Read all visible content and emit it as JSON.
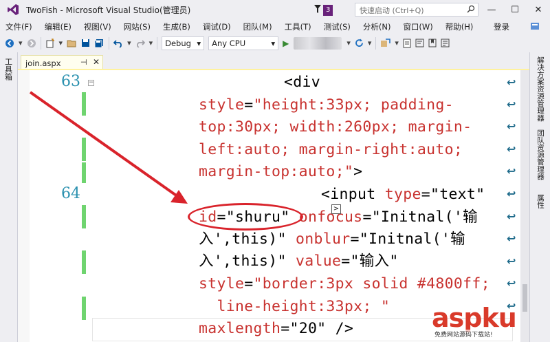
{
  "window": {
    "title": "TwoFish - Microsoft Visual Studio(管理员)",
    "notification_count": "3",
    "quick_launch_placeholder": "快速启动 (Ctrl+Q)",
    "controls": {
      "minimize": "—",
      "maximize": "☐",
      "close": "✕"
    }
  },
  "menu": {
    "items": [
      "文件(F)",
      "编辑(E)",
      "视图(V)",
      "网站(S)",
      "生成(B)",
      "调试(D)",
      "团队(M)",
      "工具(T)",
      "测试(S)",
      "分析(N)",
      "窗口(W)",
      "帮助(H)"
    ],
    "login": "登录"
  },
  "toolbar": {
    "configuration": "Debug",
    "platform": "Any CPU"
  },
  "left_dock": {
    "label": "工具箱"
  },
  "right_dock": {
    "labels": [
      "解决方案资源管理器",
      "团队资源管理器",
      "属性"
    ]
  },
  "document_tab": {
    "name": "join.aspx",
    "pin": "⊣",
    "close": "✕"
  },
  "editor": {
    "line_numbers": [
      "63",
      "64"
    ],
    "lines": [
      {
        "parts": [
          [
            "tag",
            "<div"
          ]
        ]
      },
      {
        "parts": [
          [
            "attr",
            "style"
          ],
          [
            "eq",
            "="
          ],
          [
            "attr",
            "\"height:33px; padding-"
          ]
        ]
      },
      {
        "parts": [
          [
            "attr",
            "top:30px; width:260px; margin-"
          ]
        ]
      },
      {
        "parts": [
          [
            "attr",
            "left:auto; margin-right:auto;"
          ]
        ]
      },
      {
        "parts": [
          [
            "attr",
            "margin-top:auto;\""
          ],
          [
            "tag",
            ">"
          ]
        ]
      },
      {
        "parts": [
          [
            "tag",
            "<input "
          ],
          [
            "attr",
            "type"
          ],
          [
            "eq",
            "="
          ],
          [
            "val",
            "\"text\""
          ]
        ]
      },
      {
        "parts": [
          [
            "attr",
            "id"
          ],
          [
            "eq",
            "="
          ],
          [
            "val",
            "\"shuru\""
          ],
          [
            "tag",
            " "
          ],
          [
            "attr",
            "onfocus"
          ],
          [
            "eq",
            "="
          ],
          [
            "val",
            "\"Initnal('输"
          ]
        ]
      },
      {
        "parts": [
          [
            "val",
            "入',this)\""
          ],
          [
            "tag",
            " "
          ],
          [
            "attr",
            "onblur"
          ],
          [
            "eq",
            "="
          ],
          [
            "val",
            "\"Initnal('输"
          ]
        ]
      },
      {
        "parts": [
          [
            "val",
            "入',this)\""
          ],
          [
            "tag",
            " "
          ],
          [
            "attr",
            "value"
          ],
          [
            "eq",
            "="
          ],
          [
            "val",
            "\"输入\""
          ]
        ]
      },
      {
        "parts": [
          [
            "attr",
            "style"
          ],
          [
            "eq",
            "="
          ],
          [
            "attr",
            "\"border:3px solid #4800ff;"
          ]
        ]
      },
      {
        "parts": [
          [
            "attr",
            "  line-height:33px; \""
          ]
        ]
      },
      {
        "parts": [
          [
            "attr",
            "maxlength"
          ],
          [
            "eq",
            "="
          ],
          [
            "val",
            "\"20\""
          ],
          [
            "tag",
            " />"
          ]
        ]
      }
    ],
    "smart_tag_glyph": ">"
  },
  "watermark": {
    "main_asp": "asp",
    "main_ku": "ku",
    "sub": "免费网站源码下载站!"
  },
  "colors": {
    "accent": "#68217a",
    "attr": "#c8322f",
    "linenum": "#2b91af",
    "annotation": "#d9232b",
    "changed": "#6fd46f"
  }
}
